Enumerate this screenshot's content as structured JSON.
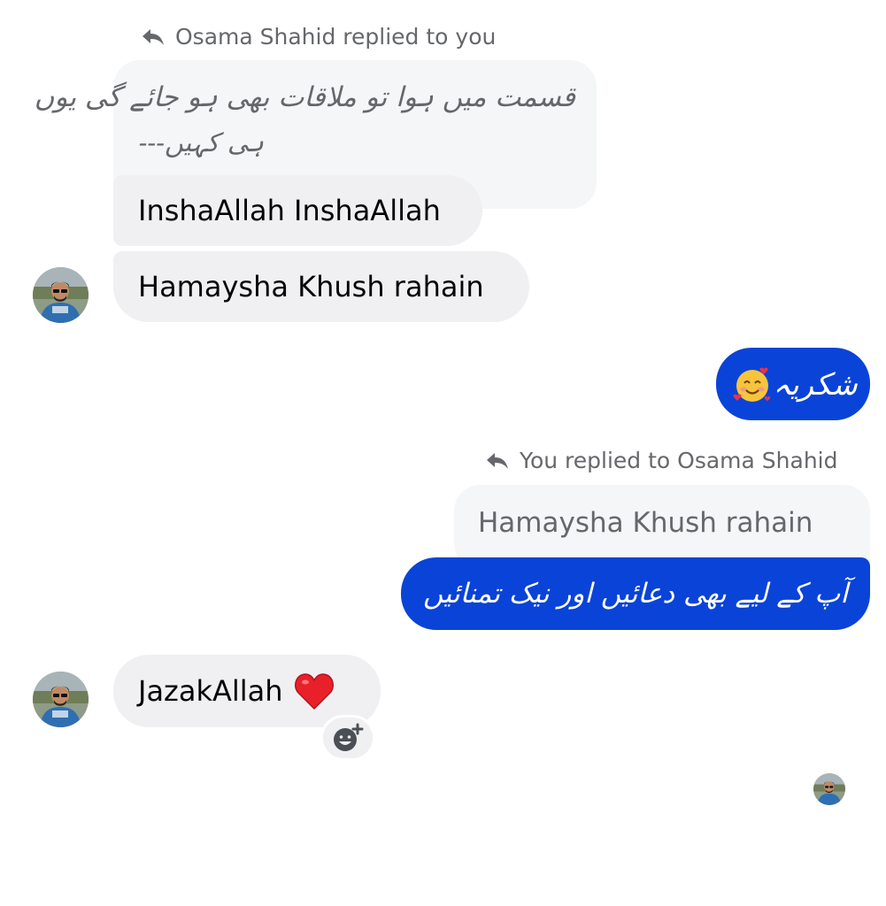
{
  "thread": {
    "reply1": {
      "label": "Osama Shahid replied to you",
      "quoted_line1": "قسمت میں ہوا تو ملاقات بھی ہو جائے گی یوں",
      "quoted_line2": "ہی کہیں---"
    },
    "msg_insha": "InshaAllah InshaAllah",
    "msg_hamaysha": "Hamaysha Khush rahain",
    "msg_shukriya": "شکریہ",
    "reply2": {
      "label": "You replied to Osama Shahid",
      "quoted": "Hamaysha Khush rahain"
    },
    "msg_duaen": "آپ کے لیے بھی دعائیں اور نیک تمنائیں",
    "msg_jazak": "JazakAllah",
    "colors": {
      "outgoing_bubble": "#0a43d8",
      "incoming_bubble": "#f0f0f2",
      "quoted_bubble": "#f5f6f7",
      "meta_text": "#65676b"
    },
    "icons": [
      "reply-arrow-icon",
      "smiling-face-with-hearts-emoji",
      "red-heart-emoji",
      "add-reaction-icon",
      "avatar"
    ]
  }
}
